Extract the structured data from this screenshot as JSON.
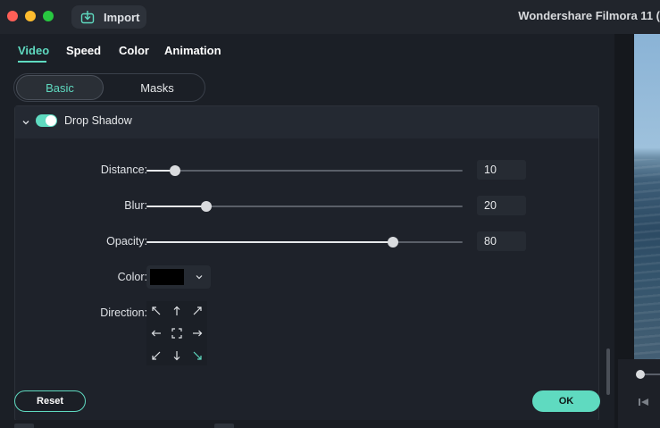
{
  "window": {
    "app_title": "Wondershare Filmora 11 (",
    "import_label": "Import"
  },
  "tabs": [
    {
      "label": "Video",
      "active": true
    },
    {
      "label": "Speed",
      "active": false
    },
    {
      "label": "Color",
      "active": false
    },
    {
      "label": "Animation",
      "active": false
    }
  ],
  "segments": {
    "basic": "Basic",
    "masks": "Masks",
    "selected": "Basic"
  },
  "drop_shadow": {
    "title": "Drop Shadow",
    "enabled": true,
    "distance": {
      "label": "Distance:",
      "value": "10",
      "fraction": 0.09
    },
    "blur": {
      "label": "Blur:",
      "value": "20",
      "fraction": 0.19
    },
    "opacity": {
      "label": "Opacity:",
      "value": "80",
      "fraction": 0.78
    },
    "color": {
      "label": "Color:",
      "value": "#000000"
    },
    "direction": {
      "label": "Direction:",
      "selected": "bottom-right"
    }
  },
  "buttons": {
    "reset": "Reset",
    "ok": "OK"
  },
  "colors": {
    "accent": "#5fdac0",
    "background": "#1b1f26"
  }
}
